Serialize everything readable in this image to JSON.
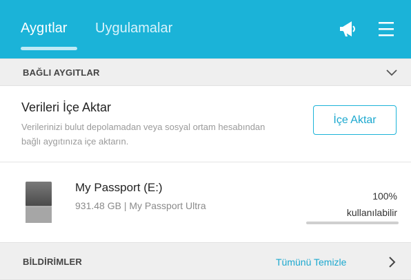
{
  "header": {
    "tabs": [
      {
        "label": "Aygıtlar",
        "active": true
      },
      {
        "label": "Uygulamalar",
        "active": false
      }
    ],
    "icons": {
      "announcements": "megaphone-icon",
      "menu": "hamburger-menu-icon"
    },
    "accent_color": "#1bb3d8"
  },
  "connected_devices": {
    "heading": "BAĞLI AYGITLAR",
    "toggle_icon": "chevron-down-icon"
  },
  "import_data": {
    "title": "Verileri İçe Aktar",
    "description": "Verilerinizi bulut depolamadan veya sosyal ortam hesabından bağlı aygıtınıza içe aktarın.",
    "button_label": "İçe Aktar"
  },
  "device": {
    "name": "My Passport (E:)",
    "info": "931.48 GB | My Passport Ultra",
    "available_percent": "100%",
    "available_label": "kullanılabilir",
    "available_fraction": 1.0,
    "icon": "hard-drive-icon"
  },
  "notifications": {
    "heading": "BİLDİRİMLER",
    "clear_all_label": "Tümünü Temizle",
    "arrow_icon": "chevron-right-icon"
  }
}
